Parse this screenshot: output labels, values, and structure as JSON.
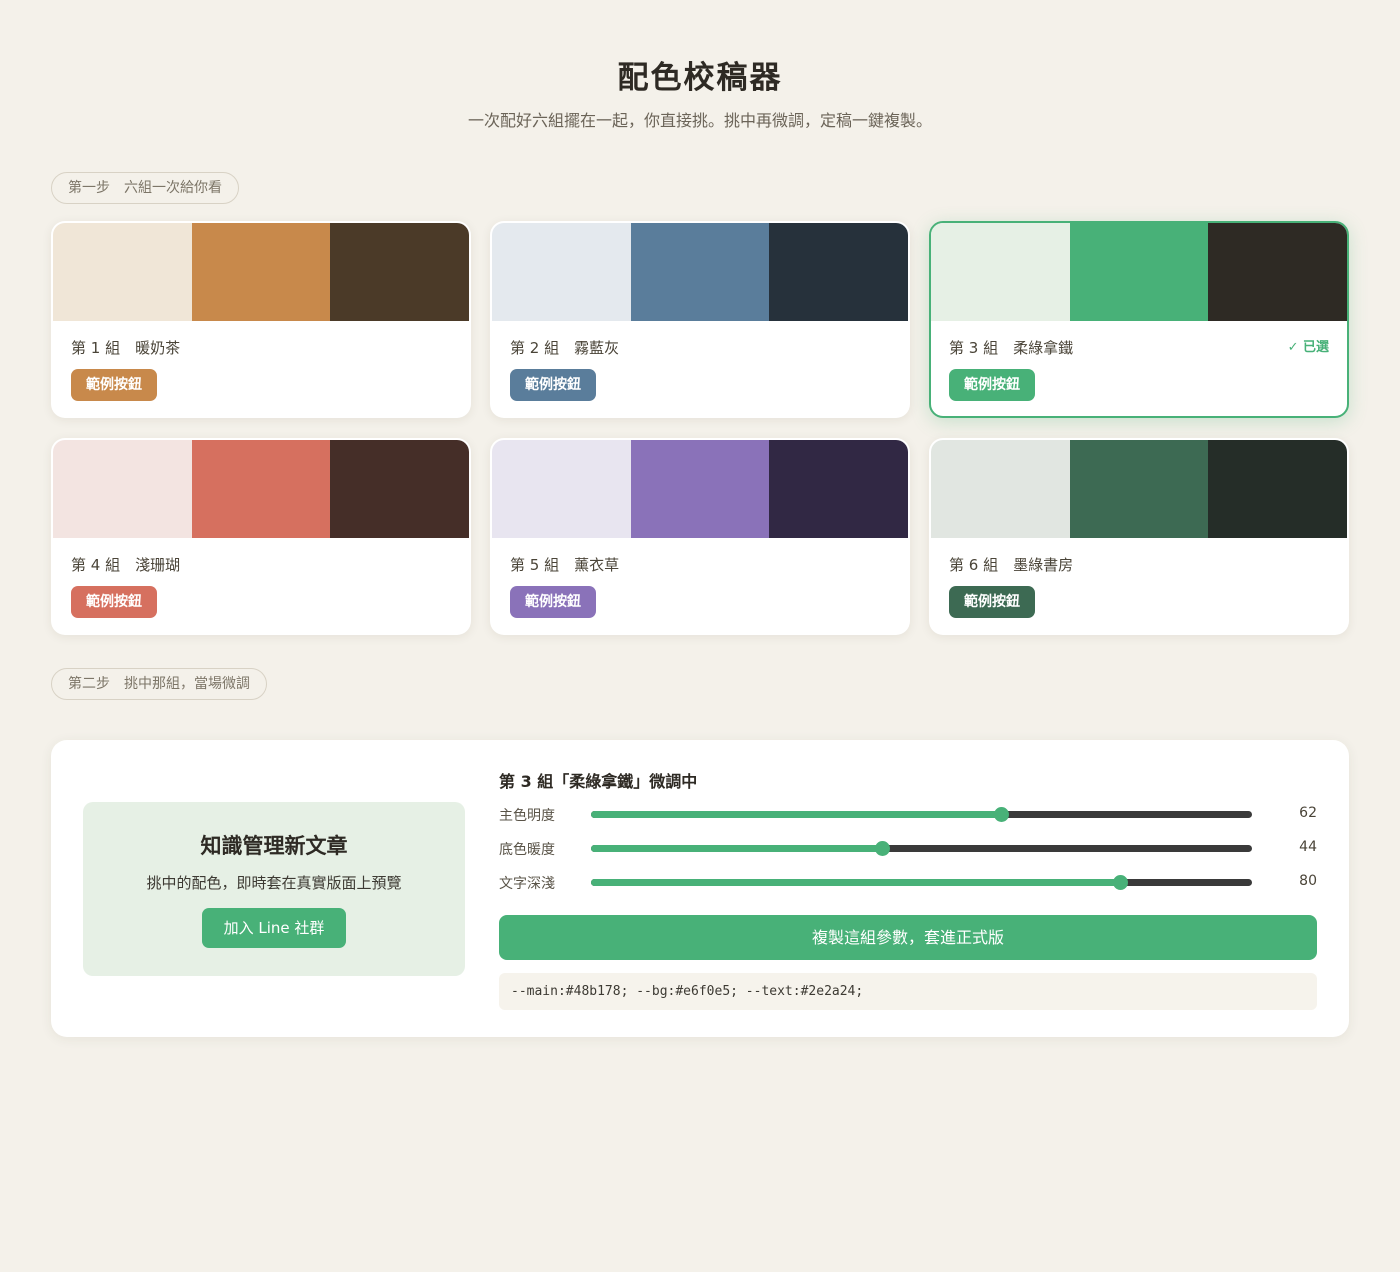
{
  "header": {
    "title": "配色校稿器",
    "subtitle": "一次配好六組擺在一起，你直接挑。挑中再微調，定稿一鍵複製。"
  },
  "steps": {
    "step1": "第一步　六組一次給你看",
    "step2": "第二步　挑中那組，當場微調"
  },
  "palettes": [
    {
      "title": "第 1 組　暖奶茶",
      "button": "範例按鈕",
      "colors": [
        "#f0e6d7",
        "#c8894b",
        "#4b3a28"
      ],
      "accent": "#c8894b",
      "selected": false
    },
    {
      "title": "第 2 組　霧藍灰",
      "button": "範例按鈕",
      "colors": [
        "#e4e9ee",
        "#5a7d9b",
        "#26313b"
      ],
      "accent": "#5a7d9b",
      "selected": false
    },
    {
      "title": "第 3 組　柔綠拿鐵",
      "button": "範例按鈕",
      "colors": [
        "#e6f0e5",
        "#48b178",
        "#2e2a24"
      ],
      "accent": "#48b178",
      "selected": true,
      "badge": "✓ 已選"
    },
    {
      "title": "第 4 組　淺珊瑚",
      "button": "範例按鈕",
      "colors": [
        "#f3e4e1",
        "#d6705f",
        "#452e28"
      ],
      "accent": "#d6705f",
      "selected": false
    },
    {
      "title": "第 5 組　薰衣草",
      "button": "範例按鈕",
      "colors": [
        "#e8e5f0",
        "#8a72b9",
        "#312844"
      ],
      "accent": "#8a72b9",
      "selected": false
    },
    {
      "title": "第 6 組　墨綠書房",
      "button": "範例按鈕",
      "colors": [
        "#e1e6e1",
        "#3d6a53",
        "#252d28"
      ],
      "accent": "#3d6a53",
      "selected": false
    }
  ],
  "tuner": {
    "title": "第 3 組「柔綠拿鐵」微調中",
    "preview": {
      "heading": "知識管理新文章",
      "text": "挑中的配色，即時套在真實版面上預覽",
      "button": "加入 Line 社群"
    },
    "sliders": [
      {
        "label": "主色明度",
        "value": 62
      },
      {
        "label": "底色暖度",
        "value": 44
      },
      {
        "label": "文字深淺",
        "value": 80
      }
    ],
    "copy_button": "複製這組參數，套進正式版",
    "code": "--main:#48b178; --bg:#e6f0e5; --text:#2e2a24;"
  }
}
